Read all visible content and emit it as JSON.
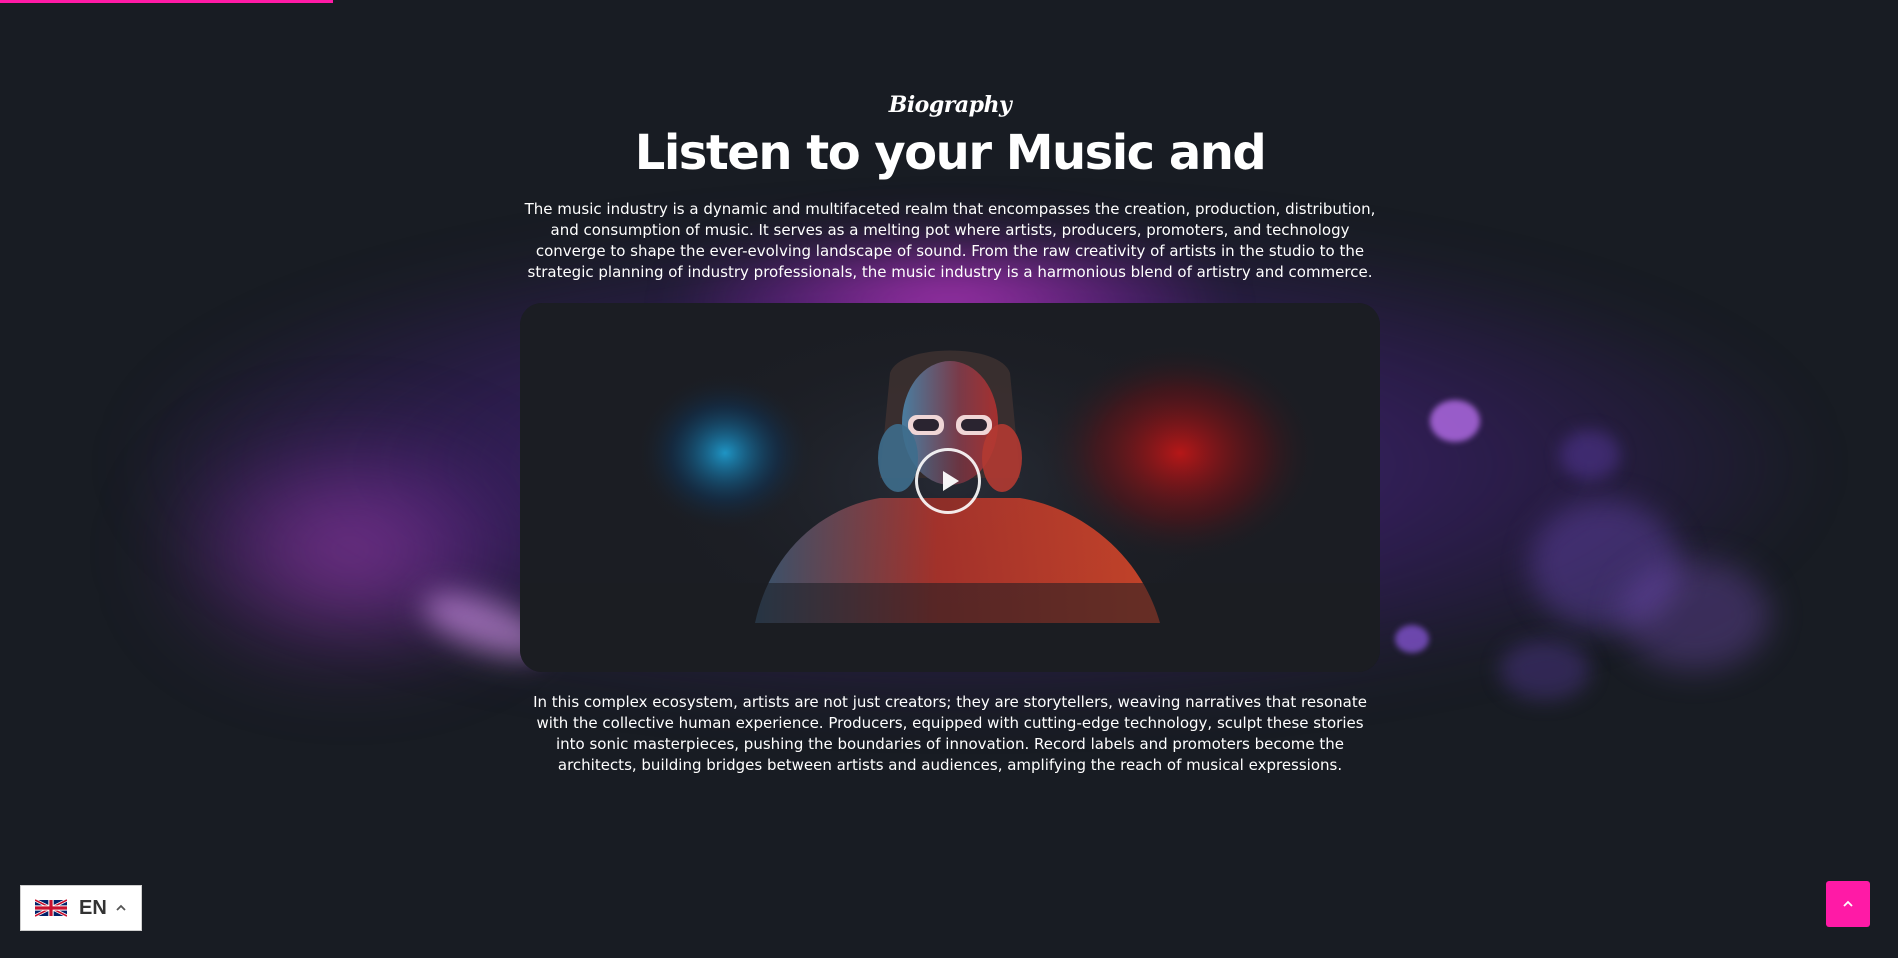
{
  "colors": {
    "background": "#181c23",
    "accent": "#ff1aa6",
    "text": "#ffffff"
  },
  "section": {
    "eyebrow": "Biography",
    "heading": "Listen to your Music and",
    "intro": "The music industry is a dynamic and multifaceted realm that encompasses the creation, production, distribution, and consumption of music. It serves as a melting pot where artists, producers, promoters, and technology converge to shape the ever-evolving landscape of sound. From the raw creativity of artists in the studio to the strategic planning of industry professionals, the music industry is a harmonious blend of artistry and commerce.",
    "outro": "In this complex ecosystem, artists are not just creators; they are storytellers, weaving narratives that resonate with the collective human experience. Producers, equipped with cutting-edge technology, sculpt these stories into sonic masterpieces, pushing the boundaries of innovation. Record labels and promoters become the architects, building bridges between artists and audiences, amplifying the reach of musical expressions."
  },
  "video": {
    "play_icon": "play-icon"
  },
  "language_switcher": {
    "code": "EN",
    "flag_icon": "uk-flag-icon",
    "chevron_icon": "chevron-up-icon"
  },
  "back_to_top": {
    "icon": "chevron-up-icon"
  }
}
